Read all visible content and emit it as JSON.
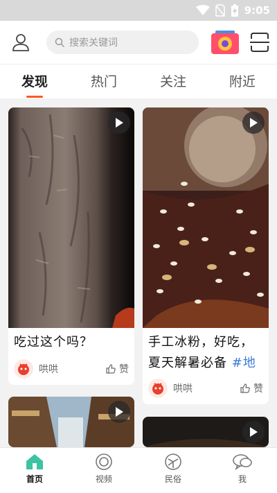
{
  "status": {
    "time": "9:05"
  },
  "search": {
    "placeholder": "搜索关键词"
  },
  "tabs": [
    "发现",
    "热门",
    "关注",
    "附近"
  ],
  "feed": [
    {
      "title": "吃过这个吗？",
      "author": "哄哄",
      "like_label": "赞"
    },
    {
      "title_line1": "手工冰粉，好吃，",
      "title_line2": "夏天解暑必备 ",
      "hashtag": "#地",
      "author": "哄哄",
      "like_label": "赞"
    }
  ],
  "bottom_nav": [
    {
      "label": "首页",
      "icon": "home-icon"
    },
    {
      "label": "视频",
      "icon": "video-icon"
    },
    {
      "label": "民俗",
      "icon": "folk-icon"
    },
    {
      "label": "我",
      "icon": "me-icon"
    }
  ],
  "colors": {
    "accent": "#ff5722",
    "hashtag": "#3a7bd5",
    "nav_active": "#3cc3a3"
  }
}
